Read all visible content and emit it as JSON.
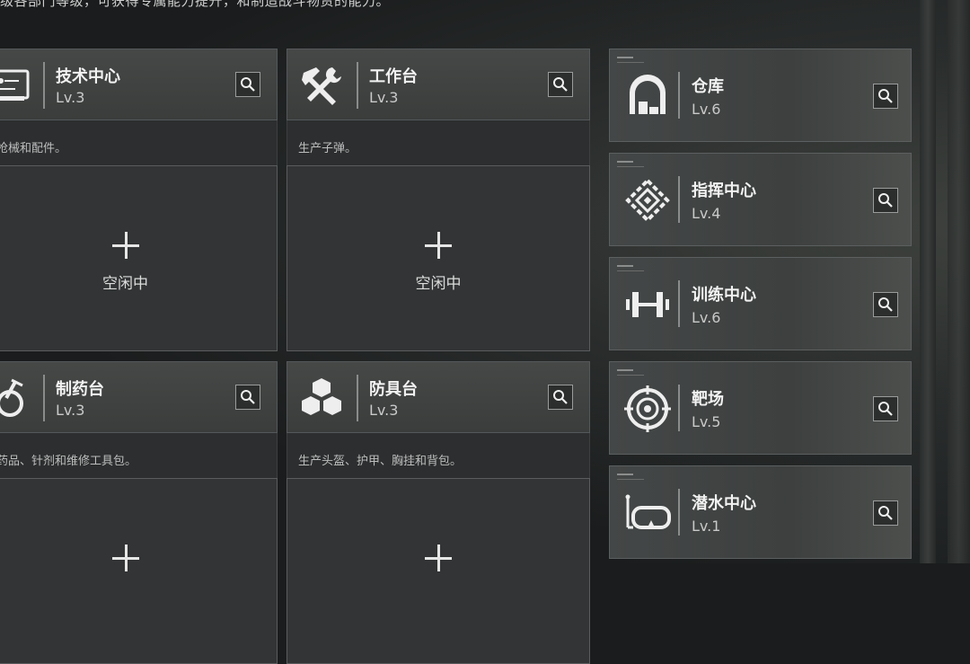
{
  "intro": "级各部门等级，可获得专属能力提升，和制造战斗物资的能力。",
  "colors": {
    "panel": "#3b3d3c",
    "border": "#55585a",
    "text": "#f2f2f2"
  },
  "facilities": [
    {
      "name": "技术中心",
      "level": "Lv.3",
      "icon": "tech-center-icon",
      "desc": "产枪械和配件。",
      "slot": "空闲中"
    },
    {
      "name": "工作台",
      "level": "Lv.3",
      "icon": "workbench-icon",
      "desc": "生产子弹。",
      "slot": "空闲中"
    },
    {
      "name": "制药台",
      "level": "Lv.3",
      "icon": "pharmacy-icon",
      "desc": "产药品、针剂和维修工具包。",
      "slot": ""
    },
    {
      "name": "防具台",
      "level": "Lv.3",
      "icon": "armor-bench-icon",
      "desc": "生产头盔、护甲、胸挂和背包。",
      "slot": ""
    }
  ],
  "side": [
    {
      "name": "仓库",
      "level": "Lv.6",
      "icon": "warehouse-icon"
    },
    {
      "name": "指挥中心",
      "level": "Lv.4",
      "icon": "command-center-icon"
    },
    {
      "name": "训练中心",
      "level": "Lv.6",
      "icon": "training-center-icon"
    },
    {
      "name": "靶场",
      "level": "Lv.5",
      "icon": "shooting-range-icon"
    },
    {
      "name": "潜水中心",
      "level": "Lv.1",
      "icon": "diving-center-icon"
    }
  ]
}
